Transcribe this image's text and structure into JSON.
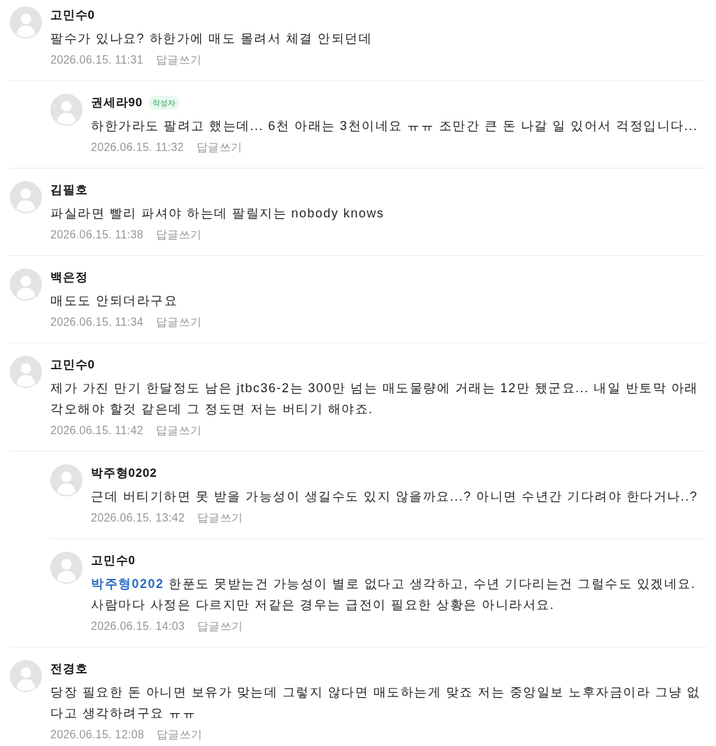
{
  "comments": [
    {
      "kind": "comment",
      "author": "고민수0",
      "text": "팔수가 있나요? 하한가에 매도 몰려서 체결 안되던데",
      "date": "2026.06.15. 11:31",
      "reply_link": "답글쓰기"
    },
    {
      "kind": "reply",
      "author": "권세라90",
      "badge": "작성자",
      "text": "하한가라도 팔려고 했는데... 6천 아래는 3천이네요 ㅠㅠ 조만간 큰 돈 나갈 일 있어서 걱정입니다...",
      "date": "2026.06.15. 11:32",
      "reply_link": "답글쓰기"
    },
    {
      "kind": "comment",
      "author": "김필호",
      "text": "파실라면 빨리 파셔야 하는데 팔릴지는 nobody knows",
      "date": "2026.06.15. 11:38",
      "reply_link": "답글쓰기"
    },
    {
      "kind": "comment",
      "author": "백은정",
      "text": "매도도 안되더라구요",
      "date": "2026.06.15. 11:34",
      "reply_link": "답글쓰기"
    },
    {
      "kind": "comment",
      "author": "고민수0",
      "text": "제가 가진 만기 한달정도 남은 jtbc36-2는 300만 넘는 매도물량에 거래는 12만 됐군요... 내일 반토막 아래 각오해야 할것 같은데 그 정도면 저는 버티기 해야죠.",
      "date": "2026.06.15. 11:42",
      "reply_link": "답글쓰기"
    },
    {
      "kind": "reply",
      "author": "박주형0202",
      "text": "근데 버티기하면 못 받을 가능성이 생길수도 있지 않을까요...? 아니면 수년간 기다려야 한다거나..?",
      "date": "2026.06.15. 13:42",
      "reply_link": "답글쓰기"
    },
    {
      "kind": "reply",
      "author": "고민수0",
      "mention": "박주형0202",
      "text": "한푼도 못받는건 가능성이 별로 없다고 생각하고, 수년 기다리는건 그럴수도 있겠네요. 사람마다 사정은 다르지만 저같은 경우는 급전이 필요한 상황은 아니라서요.",
      "date": "2026.06.15. 14:03",
      "reply_link": "답글쓰기"
    },
    {
      "kind": "comment",
      "author": "전경호",
      "text": "당장 필요한 돈 아니면 보유가 맞는데 그렇지 않다면 매도하는게 맞죠 저는 중앙일보 노후자금이라 그냥 없다고 생각하려구요 ㅠㅠ",
      "date": "2026.06.15. 12:08",
      "reply_link": "답글쓰기"
    }
  ]
}
